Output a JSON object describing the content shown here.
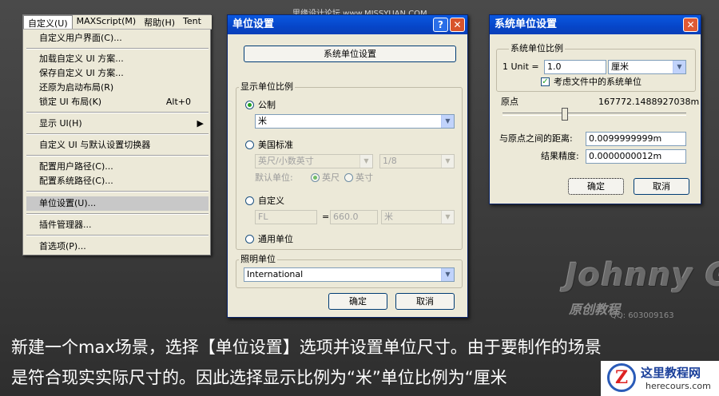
{
  "watermark": "思缘设计论坛 www.MISSYUAN.COM",
  "menubar": [
    "自定义(U)",
    "MAXScript(M)",
    "帮助(H)",
    "Tent"
  ],
  "menu": {
    "items": [
      {
        "label": "自定义用户界面(C)...",
        "shortcut": ""
      },
      {
        "label": "加载自定义 UI 方案...",
        "shortcut": ""
      },
      {
        "label": "保存自定义 UI 方案...",
        "shortcut": ""
      },
      {
        "label": "还原为启动布局(R)",
        "shortcut": ""
      },
      {
        "label": "锁定 UI 布局(K)",
        "shortcut": "Alt+0"
      },
      {
        "label": "显示 UI(H)",
        "shortcut": ""
      },
      {
        "label": "自定义 UI 与默认设置切换器",
        "shortcut": ""
      },
      {
        "label": "配置用户路径(C)...",
        "shortcut": ""
      },
      {
        "label": "配置系统路径(C)...",
        "shortcut": ""
      },
      {
        "label": "单位设置(U)...",
        "shortcut": ""
      },
      {
        "label": "插件管理器...",
        "shortcut": ""
      },
      {
        "label": "首选项(P)...",
        "shortcut": ""
      }
    ]
  },
  "units_dialog": {
    "title": "单位设置",
    "system_units_button": "系统单位设置",
    "display_group": "显示单位比例",
    "metric_label": "公制",
    "metric_value": "米",
    "us_label": "美国标准",
    "us_unit": "英尺/小数英寸",
    "us_fraction": "1/8",
    "default_unit_label": "默认单位:",
    "default_feet": "英尺",
    "default_inches": "英寸",
    "custom_label": "自定义",
    "custom_name": "FL",
    "custom_eq": "=",
    "custom_value": "660.0",
    "custom_unit": "米",
    "generic_label": "通用单位",
    "lighting_group": "照明单位",
    "lighting_value": "International",
    "ok": "确定",
    "cancel": "取消"
  },
  "system_dialog": {
    "title": "系统单位设置",
    "scale_group": "系统单位比例",
    "unit_prefix": "1 Unit =",
    "unit_value": "1.0",
    "unit_type": "厘米",
    "respect_label": "考虑文件中的系统单位",
    "origin_label": "原点",
    "origin_value": "167772.1488927038m",
    "distance_label": "与原点之间的距离:",
    "distance_value": "0.0099999999m",
    "precision_label": "结果精度:",
    "precision_value": "0.0000000012m",
    "ok": "确定",
    "cancel": "取消"
  },
  "logo": {
    "main": "Johnny G",
    "sub": "原创教程",
    "qq": "QQ: 603009163"
  },
  "caption": [
    "新建一个max场景，选择【单位设置】选项并设置单位尺寸。由于要制作的场景",
    "是符合现实实际尺寸的。因此选择显示比例为“米”单位比例为“厘米"
  ],
  "badge": {
    "mark": "Z",
    "name": "这里教程网",
    "url": "herecours.com"
  }
}
